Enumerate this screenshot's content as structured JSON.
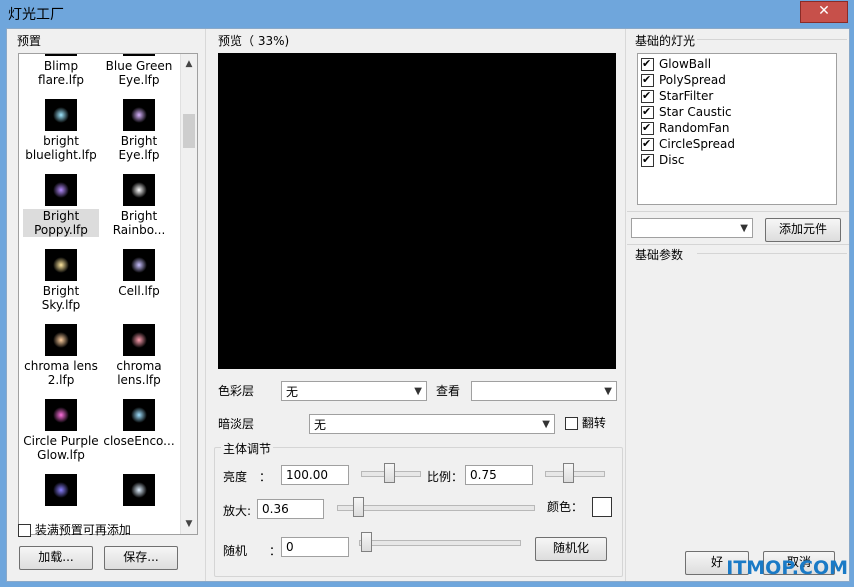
{
  "window": {
    "title": "灯光工厂",
    "close_glyph": "✕"
  },
  "presets": {
    "label": "预置",
    "items": [
      {
        "name": "Blimp flare.lfp",
        "line1": "Blimp",
        "line2": "flare.lfp"
      },
      {
        "name": "Blue Green Eye.lfp",
        "line1": "Blue Green",
        "line2": "Eye.lfp"
      },
      {
        "name": "bright bluelight.lfp",
        "line1": "bright",
        "line2": "bluelight.lfp"
      },
      {
        "name": "Bright Eye.lfp",
        "line1": "Bright",
        "line2": "Eye.lfp"
      },
      {
        "name": "Bright Poppy.lfp",
        "line1": "Bright",
        "line2": "Poppy.lfp"
      },
      {
        "name": "Bright Rainbo...",
        "line1": "Bright",
        "line2": "Rainbo..."
      },
      {
        "name": "Bright Sky.lfp",
        "line1": "Bright",
        "line2": "Sky.lfp"
      },
      {
        "name": "Cell.lfp",
        "line1": "Cell.lfp",
        "line2": ""
      },
      {
        "name": "chroma lens 2.lfp",
        "line1": "chroma lens",
        "line2": "2.lfp"
      },
      {
        "name": "chroma lens.lfp",
        "line1": "chroma",
        "line2": "lens.lfp"
      },
      {
        "name": "Circle Purple Glow.lfp",
        "line1": "Circle Purple",
        "line2": "Glow.lfp"
      },
      {
        "name": "closeEnco...",
        "line1": "closeEnco...",
        "line2": ""
      },
      {
        "name": "",
        "line1": "",
        "line2": ""
      },
      {
        "name": "",
        "line1": "",
        "line2": ""
      }
    ],
    "selected_index": 4,
    "fill_checkbox_label": "装满预置可再添加",
    "load_button": "加载...",
    "save_button": "保存..."
  },
  "preview": {
    "label": "预览（   33%)",
    "color_layer_label": "色彩层",
    "color_layer_value": "无",
    "view_label": "查看",
    "view_value": "",
    "fade_layer_label": "暗淡层",
    "fade_layer_value": "无",
    "flip_label": "翻转"
  },
  "main_adjust": {
    "group_label": "主体调节",
    "brightness_label": "亮度",
    "brightness_value": "100.00",
    "scale_label": "比例：",
    "scale_value": "0.75",
    "zoom_label": "放大:",
    "zoom_value": "0.36",
    "color_label": "颜色：",
    "random_label": "随机",
    "random_colon": "：",
    "random_value": "0",
    "randomize_button": "随机化",
    "colon": "："
  },
  "lights": {
    "label": "基础的灯光",
    "items": [
      {
        "name": "GlowBall",
        "checked": true
      },
      {
        "name": "PolySpread",
        "checked": true
      },
      {
        "name": "StarFilter",
        "checked": true
      },
      {
        "name": "Star Caustic",
        "checked": true
      },
      {
        "name": "RandomFan",
        "checked": true
      },
      {
        "name": "CircleSpread",
        "checked": true
      },
      {
        "name": "Disc",
        "checked": true
      }
    ],
    "element_select_value": "",
    "add_element_button": "添加元件",
    "params_label": "基础参数",
    "ok_button": "好",
    "cancel_button": "取消"
  },
  "watermark": "ITMOP.COM"
}
